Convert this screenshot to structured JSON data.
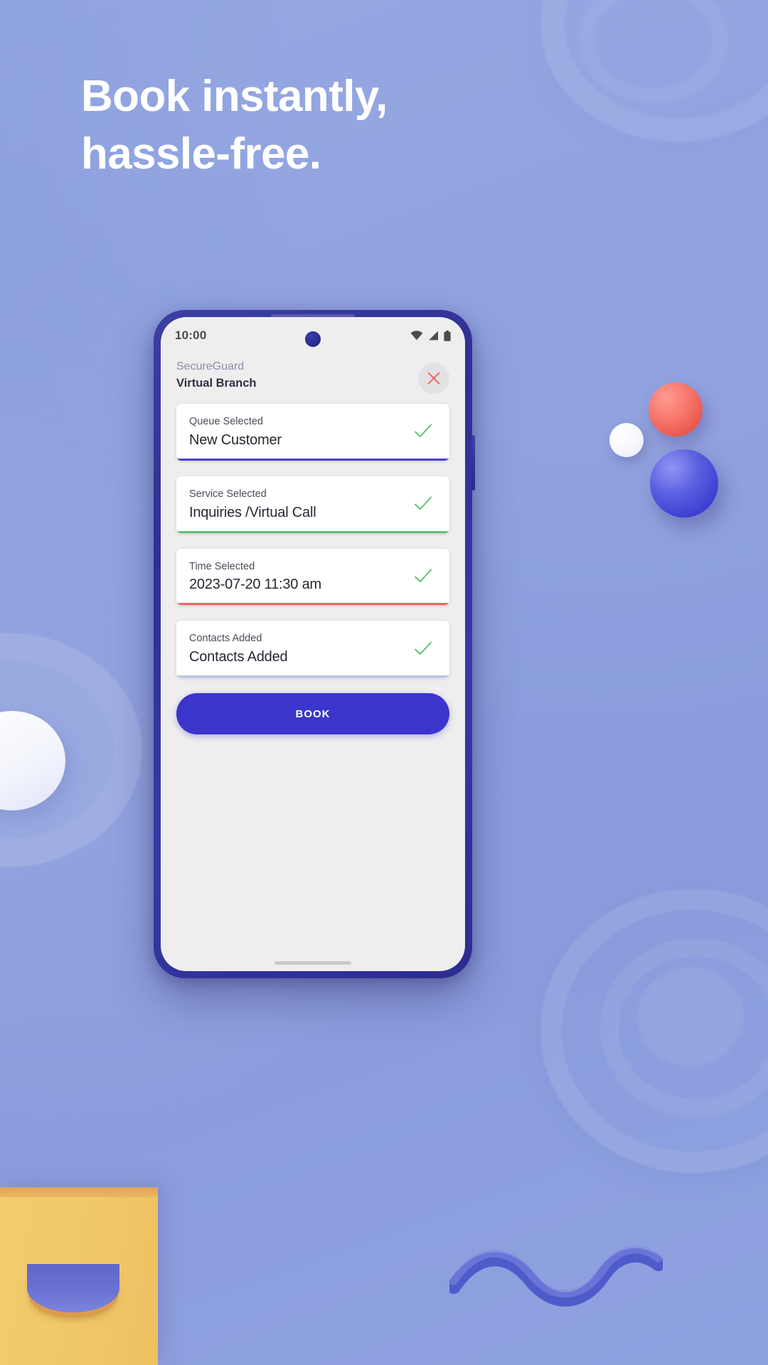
{
  "headline": {
    "line1": "Book instantly,",
    "line2": "hassle-free."
  },
  "colors": {
    "background": "#8a9ddd",
    "phone_frame": "#2f2f93",
    "primary_button": "#3b35cc",
    "check_green": "#5fc46a",
    "close_red": "#e8605a",
    "accent_indigo": "#4a3fd0",
    "accent_green": "#5fbf74",
    "accent_red": "#e8685c",
    "accent_light": "#b9c2ea",
    "yellow_card": "#f1c868"
  },
  "phone": {
    "status_bar": {
      "time": "10:00",
      "icons": [
        "wifi-icon",
        "signal-icon",
        "battery-icon"
      ]
    },
    "app_header": {
      "brand": "SecureGuard",
      "title": "Virtual Branch",
      "close_icon": "close-icon"
    },
    "cards": [
      {
        "label": "Queue Selected",
        "value": "New Customer",
        "status_icon": "check-icon",
        "accent": "#4a3fd0"
      },
      {
        "label": "Service Selected",
        "value": "Inquiries /Virtual Call",
        "status_icon": "check-icon",
        "accent": "#5fbf74"
      },
      {
        "label": "Time Selected",
        "value": "2023-07-20 11:30 am",
        "status_icon": "check-icon",
        "accent": "#e8685c"
      },
      {
        "label": "Contacts Added",
        "value": "Contacts Added",
        "status_icon": "check-icon",
        "accent": "#b9c2ea"
      }
    ],
    "book_button": "BOOK"
  }
}
